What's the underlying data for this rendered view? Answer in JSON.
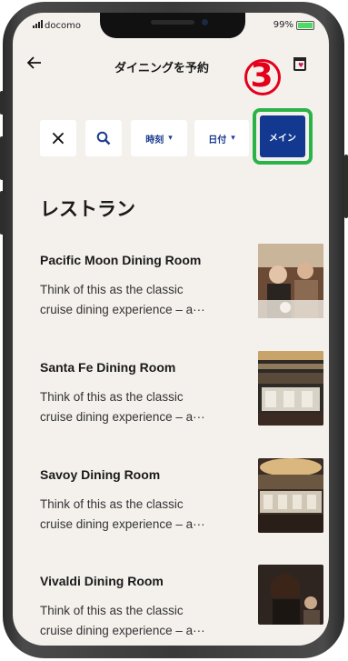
{
  "status_bar": {
    "carrier": "docomo",
    "battery": "99%"
  },
  "header": {
    "title": "ダイニングを予約",
    "annotation_number": "3"
  },
  "filters": {
    "close_symbol": "×",
    "time_label": "時刻",
    "date_label": "日付",
    "main_label": "メイン"
  },
  "section_title": "レストラン",
  "restaurants": [
    {
      "name": "Pacific Moon Dining Room",
      "desc_line1": "Think of this as the classic",
      "desc_line2": "cruise dining experience – a···"
    },
    {
      "name": "Santa Fe Dining Room",
      "desc_line1": "Think of this as the classic",
      "desc_line2": "cruise dining experience – a···"
    },
    {
      "name": "Savoy Dining Room",
      "desc_line1": "Think of this as the classic",
      "desc_line2": "cruise dining experience – a···"
    },
    {
      "name": "Vivaldi Dining Room",
      "desc_line1": "Think of this as the classic",
      "desc_line2": "cruise dining experience – a···"
    }
  ],
  "colors": {
    "accent": "#13388f",
    "annotation_red": "#e4001b",
    "highlight_green": "#2bb34a",
    "screen_bg": "#f4f1ed"
  }
}
